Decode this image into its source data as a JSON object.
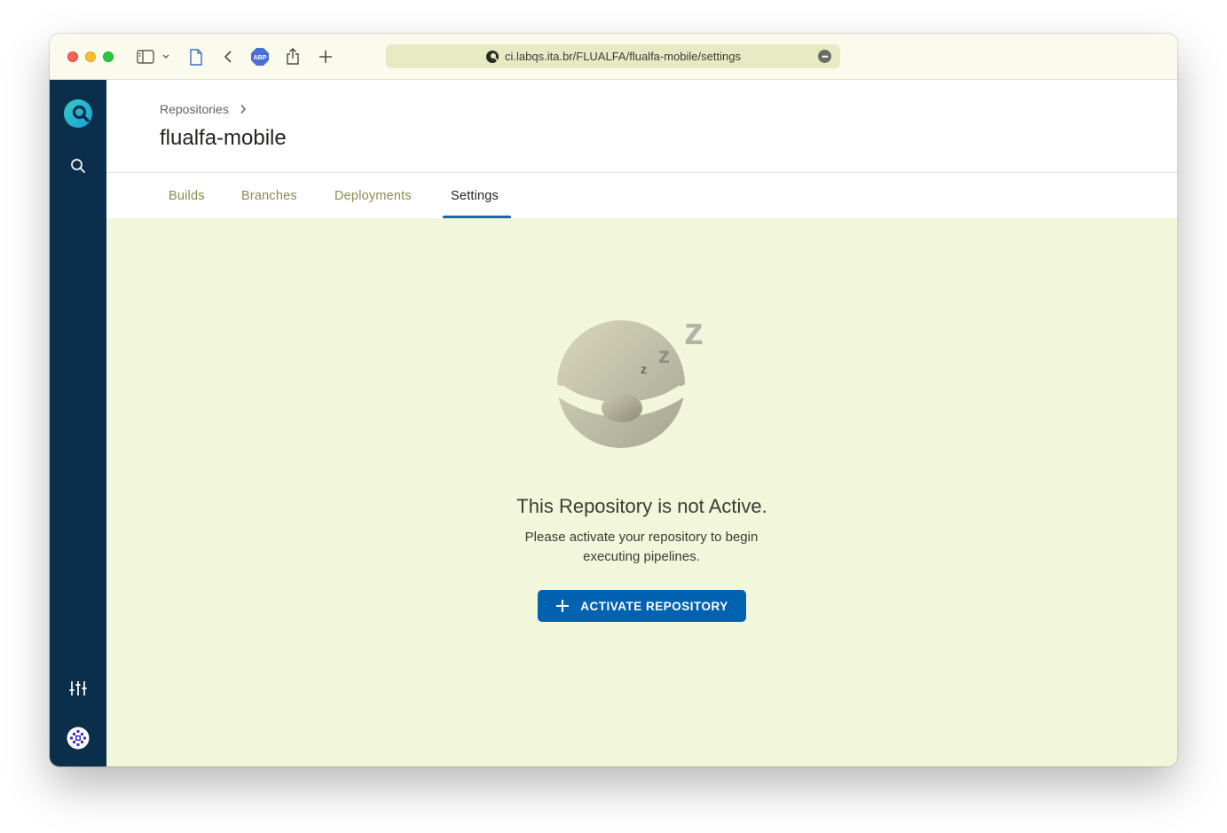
{
  "browser": {
    "url": "ci.labqs.ita.br/FLUALFA/flualfa-mobile/settings",
    "icons": [
      "sidebar-toggle-icon",
      "chevron-down-icon",
      "page-icon",
      "back-icon",
      "adblock-icon",
      "share-icon",
      "new-tab-icon",
      "site-icon",
      "more-icon"
    ],
    "adblock_label": "ABP"
  },
  "sidebar": {
    "icons": [
      "drone-logo-icon",
      "search-icon",
      "settings-sliders-icon",
      "user-avatar-icon"
    ]
  },
  "header": {
    "breadcrumb": "Repositories",
    "title": "flualfa-mobile"
  },
  "tabs": [
    {
      "label": "Builds",
      "active": false
    },
    {
      "label": "Branches",
      "active": false
    },
    {
      "label": "Deployments",
      "active": false
    },
    {
      "label": "Settings",
      "active": true
    }
  ],
  "empty_state": {
    "title": "This Repository is not Active.",
    "description": "Please activate your repository to begin executing pipelines.",
    "button_label": "ACTIVATE REPOSITORY"
  },
  "colors": {
    "sidebar_bg": "#0b2f4a",
    "content_bg": "#f2f6da",
    "accent": "#0062b1",
    "tab_active_underline": "#1768a8"
  }
}
